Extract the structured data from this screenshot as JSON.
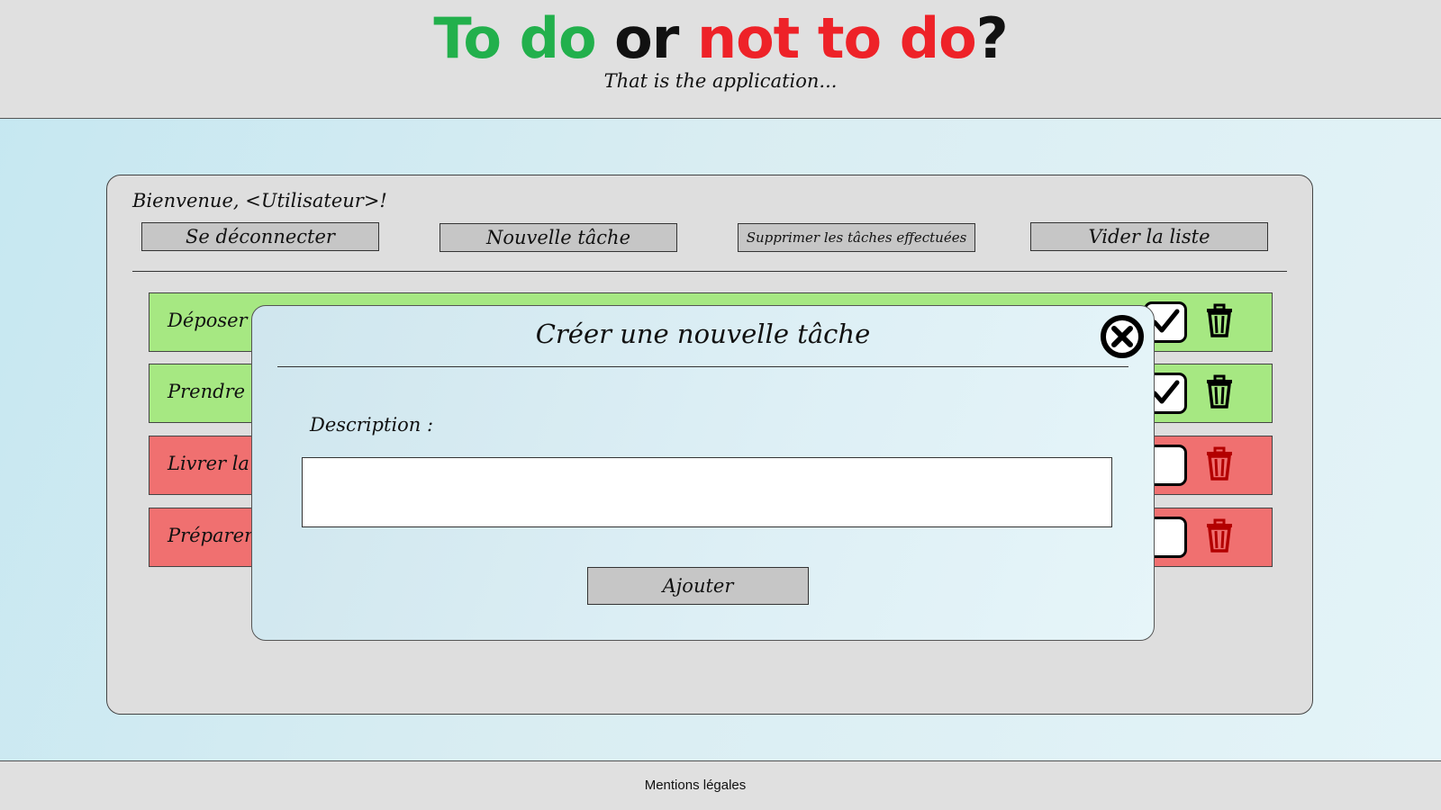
{
  "header": {
    "title_parts": [
      "To",
      "do",
      "or",
      "not to do",
      "?"
    ],
    "title_colors": [
      "#22b04c",
      "#22b04c",
      "#111111",
      "#ee2228",
      "#111111"
    ],
    "tagline": "That is the application..."
  },
  "panel": {
    "welcome": "Bienvenue, <Utilisateur>!",
    "buttons": {
      "logout": "Se déconnecter",
      "new_task": "Nouvelle tâche",
      "delete_done": "Supprimer les tâches effectuées",
      "clear_list": "Vider la liste"
    },
    "tasks": [
      {
        "label": "Déposer",
        "done": true,
        "check_icon": "checkmark-icon",
        "delete_icon": "trash-icon"
      },
      {
        "label": "Prendre",
        "done": true,
        "check_icon": "checkmark-icon",
        "delete_icon": "trash-icon"
      },
      {
        "label": "Livrer la",
        "done": false,
        "check_icon": "empty-checkbox-icon",
        "delete_icon": "trash-icon"
      },
      {
        "label": "Préparer",
        "done": false,
        "check_icon": "empty-checkbox-icon",
        "delete_icon": "trash-icon"
      }
    ],
    "colors": {
      "done": "#a6e882",
      "todo": "#f07070",
      "icon_done": "#000000",
      "icon_todo": "#b30000"
    }
  },
  "modal": {
    "title": "Créer une nouvelle tâche",
    "close_icon": "close-circle-icon",
    "description_label": "Description :",
    "description_value": "",
    "description_placeholder": "",
    "submit": "Ajouter"
  },
  "footer": {
    "link": "Mentions légales"
  }
}
